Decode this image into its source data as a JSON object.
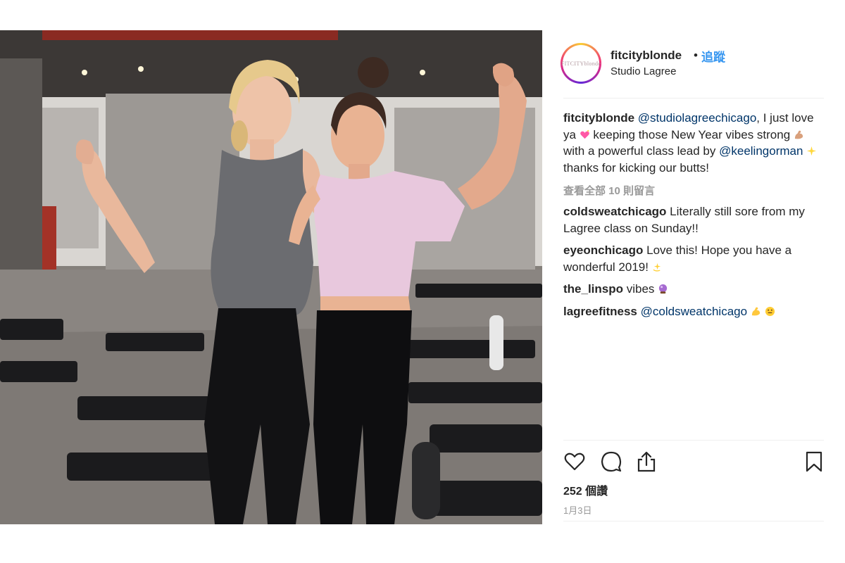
{
  "post": {
    "username": "fitcityblonde",
    "separator": "•",
    "follow_label": "追蹤",
    "location": "Studio Lagree",
    "avatar_text": "FITCITYblonde",
    "caption": {
      "author": "fitcityblonde",
      "mention_1": "@studiolagreechicago",
      "text_1": ", I just love ya",
      "emoji_1": "sparkling-heart",
      "text_2": "  keeping those New Year vibes strong",
      "emoji_2": "flexed-biceps",
      "text_3": "  with a powerful class lead by ",
      "mention_2": "@keelingorman",
      "emoji_3": "sparkles",
      "text_4": "  thanks for kicking our butts!"
    },
    "view_all_comments": "查看全部 10 則留言",
    "comments": [
      {
        "user": "coldsweatchicago",
        "text": "Literally still sore from my Lagree class on Sunday!!"
      },
      {
        "user": "eyeonchicago",
        "text": "Love this! Hope you have a wonderful 2019!",
        "emoji": "dizzy"
      },
      {
        "user": "the_linspo",
        "text": "vibes",
        "emoji": "crystal-ball"
      },
      {
        "user": "lagreefitness",
        "mention": "@coldsweatchicago",
        "emoji": "flexed-biceps",
        "emoji_2": "grinning-face"
      }
    ],
    "likes": "252 個讚",
    "date": "1月3日"
  },
  "icons": {
    "like": "heart-icon",
    "comment": "comment-icon",
    "share": "share-icon",
    "save": "bookmark-icon"
  },
  "colors": {
    "link": "#3897f0",
    "mention": "#003569",
    "muted": "#999999",
    "text": "#262626"
  }
}
